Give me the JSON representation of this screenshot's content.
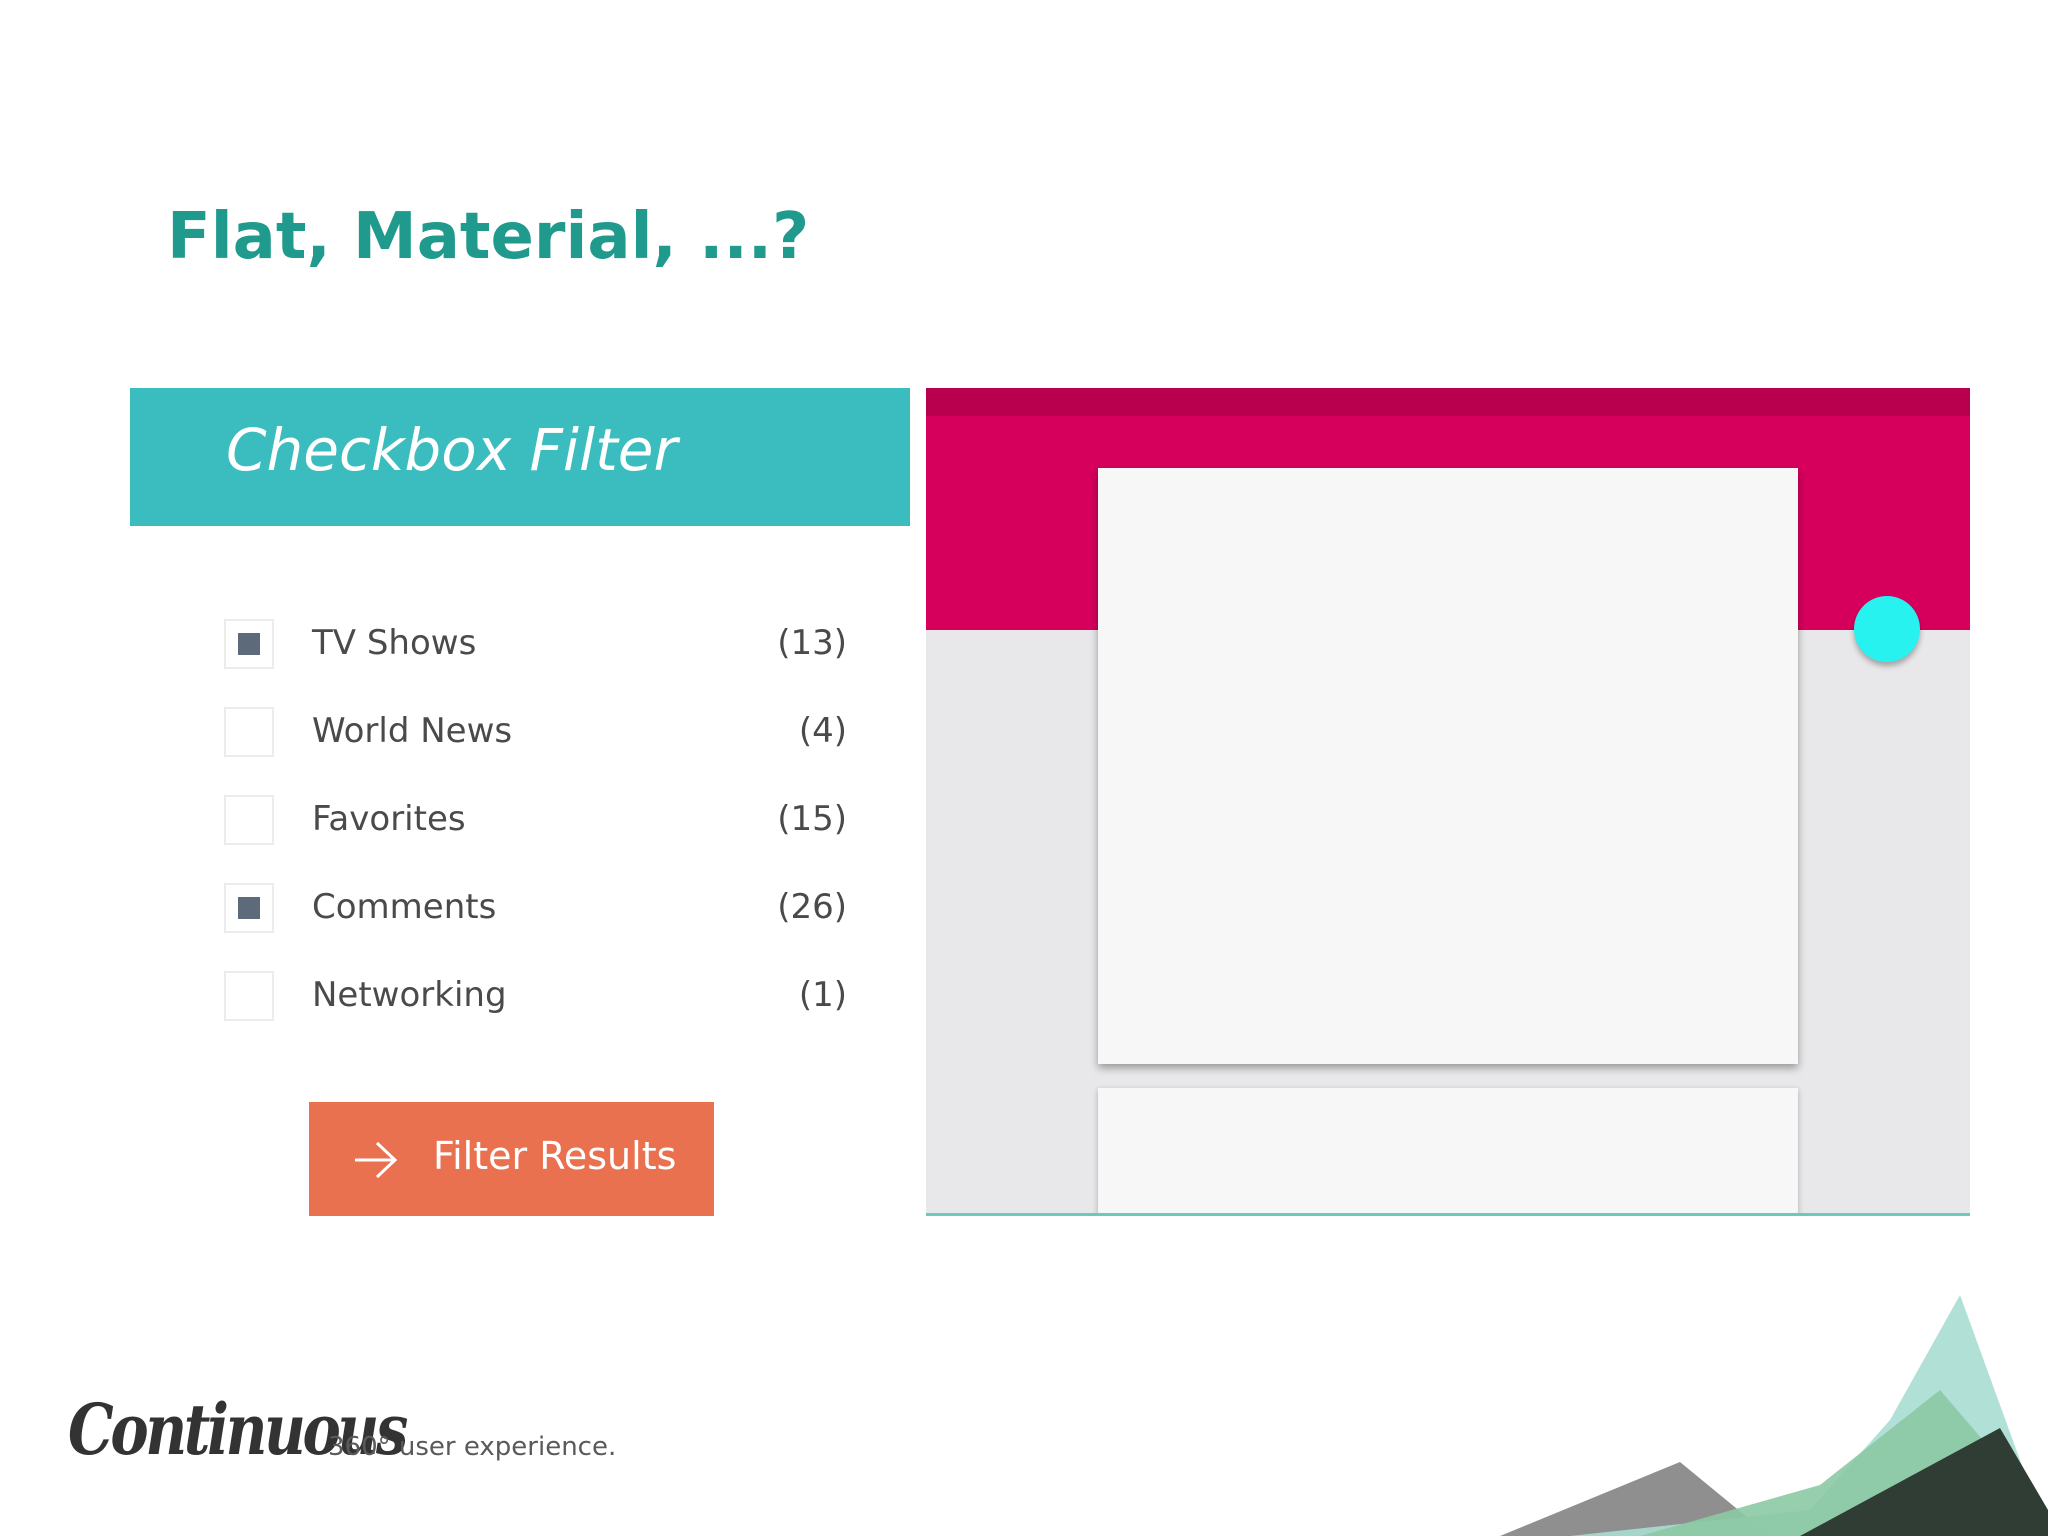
{
  "slide": {
    "title": "Flat, Material, ...?"
  },
  "flat_example": {
    "header_title": "Checkbox Filter",
    "items": [
      {
        "label": "TV Shows",
        "count": "(13)",
        "checked": true
      },
      {
        "label": "World News",
        "count": "(4)",
        "checked": false
      },
      {
        "label": "Favorites",
        "count": "(15)",
        "checked": false
      },
      {
        "label": "Comments",
        "count": "(26)",
        "checked": true
      },
      {
        "label": "Networking",
        "count": "(1)",
        "checked": false
      }
    ],
    "button_label": "Filter Results",
    "button_icon": "arrow-right-icon"
  },
  "material_example": {
    "fab_icon": "circle-fab"
  },
  "footer": {
    "brand": "Continuous",
    "tagline": "360° user experience."
  },
  "colors": {
    "title": "#1f9a8d",
    "flat_header": "#3bbdc0",
    "checkbox_fill": "#5c6a79",
    "button": "#ea7150",
    "material_appbar": "#d6005c",
    "material_statusbar": "#b8004f",
    "material_fab": "#27f2f0",
    "material_background": "#e8e8ea"
  }
}
